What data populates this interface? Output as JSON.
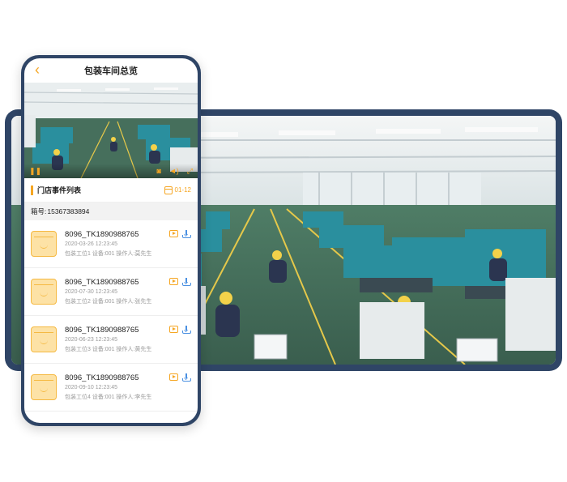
{
  "phone": {
    "title": "包装车间总览",
    "events_title": "门店事件列表",
    "date": "01-12",
    "box_label": "箱号:",
    "box_number": "15367383894",
    "events": [
      {
        "name": "8096_TK1890988765",
        "time": "2020-03-26 12:23:45",
        "meta": "包装工位1 设备:001 操作人:莫先生"
      },
      {
        "name": "8096_TK1890988765",
        "time": "2020-07-30 12:23:45",
        "meta": "包装工位2 设备:001 操作人:张先生"
      },
      {
        "name": "8096_TK1890988765",
        "time": "2020-06-23 12:23:45",
        "meta": "包装工位3 设备:001 操作人:黄先生"
      },
      {
        "name": "8096_TK1890988765",
        "time": "2020-09-10 12:23:45",
        "meta": "包装工位4 设备:001 操作人:李先生"
      }
    ]
  },
  "icons": {
    "back": "chevron-left-icon",
    "pause": "pause-icon",
    "camera": "camera-icon",
    "volume": "volume-icon",
    "fullscreen": "fullscreen-icon",
    "calendar": "calendar-icon",
    "package": "package-icon",
    "play": "play-icon",
    "download": "download-icon"
  },
  "colors": {
    "frame": "#2f4566",
    "accent": "#f5a623",
    "download": "#4a90e2"
  }
}
